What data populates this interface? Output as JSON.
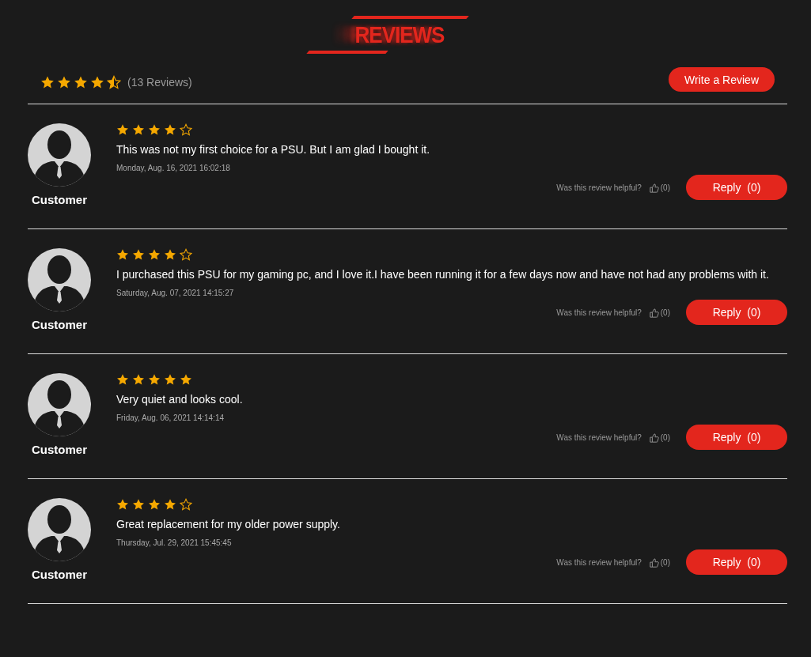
{
  "heading": "REVIEWS",
  "summary": {
    "stars": 4.5,
    "count": "(13 Reviews)",
    "write_button": "Write a Review"
  },
  "reviews": [
    {
      "author": "Customer",
      "stars": 4,
      "text": "This was not my first choice for a PSU. But I am glad I bought it.",
      "date": "Monday, Aug. 16, 2021 16:02:18",
      "helpful_prompt": "Was this review helpful?",
      "likes": "(0)",
      "reply": "Reply  (0)"
    },
    {
      "author": "Customer",
      "stars": 4,
      "text": "I purchased this PSU for my gaming pc, and I love it.I have been running it for a few days now and have not had any problems with it.",
      "date": "Saturday, Aug. 07, 2021 14:15:27",
      "helpful_prompt": "Was this review helpful?",
      "likes": "(0)",
      "reply": "Reply  (0)"
    },
    {
      "author": "Customer",
      "stars": 5,
      "text": "Very quiet and looks cool.",
      "date": "Friday, Aug. 06, 2021 14:14:14",
      "helpful_prompt": "Was this review helpful?",
      "likes": "(0)",
      "reply": "Reply  (0)"
    },
    {
      "author": "Customer",
      "stars": 4,
      "text": "Great replacement for my older power supply.",
      "date": "Thursday, Jul. 29, 2021 15:45:45",
      "helpful_prompt": "Was this review helpful?",
      "likes": "(0)",
      "reply": "Reply  (0)"
    }
  ]
}
